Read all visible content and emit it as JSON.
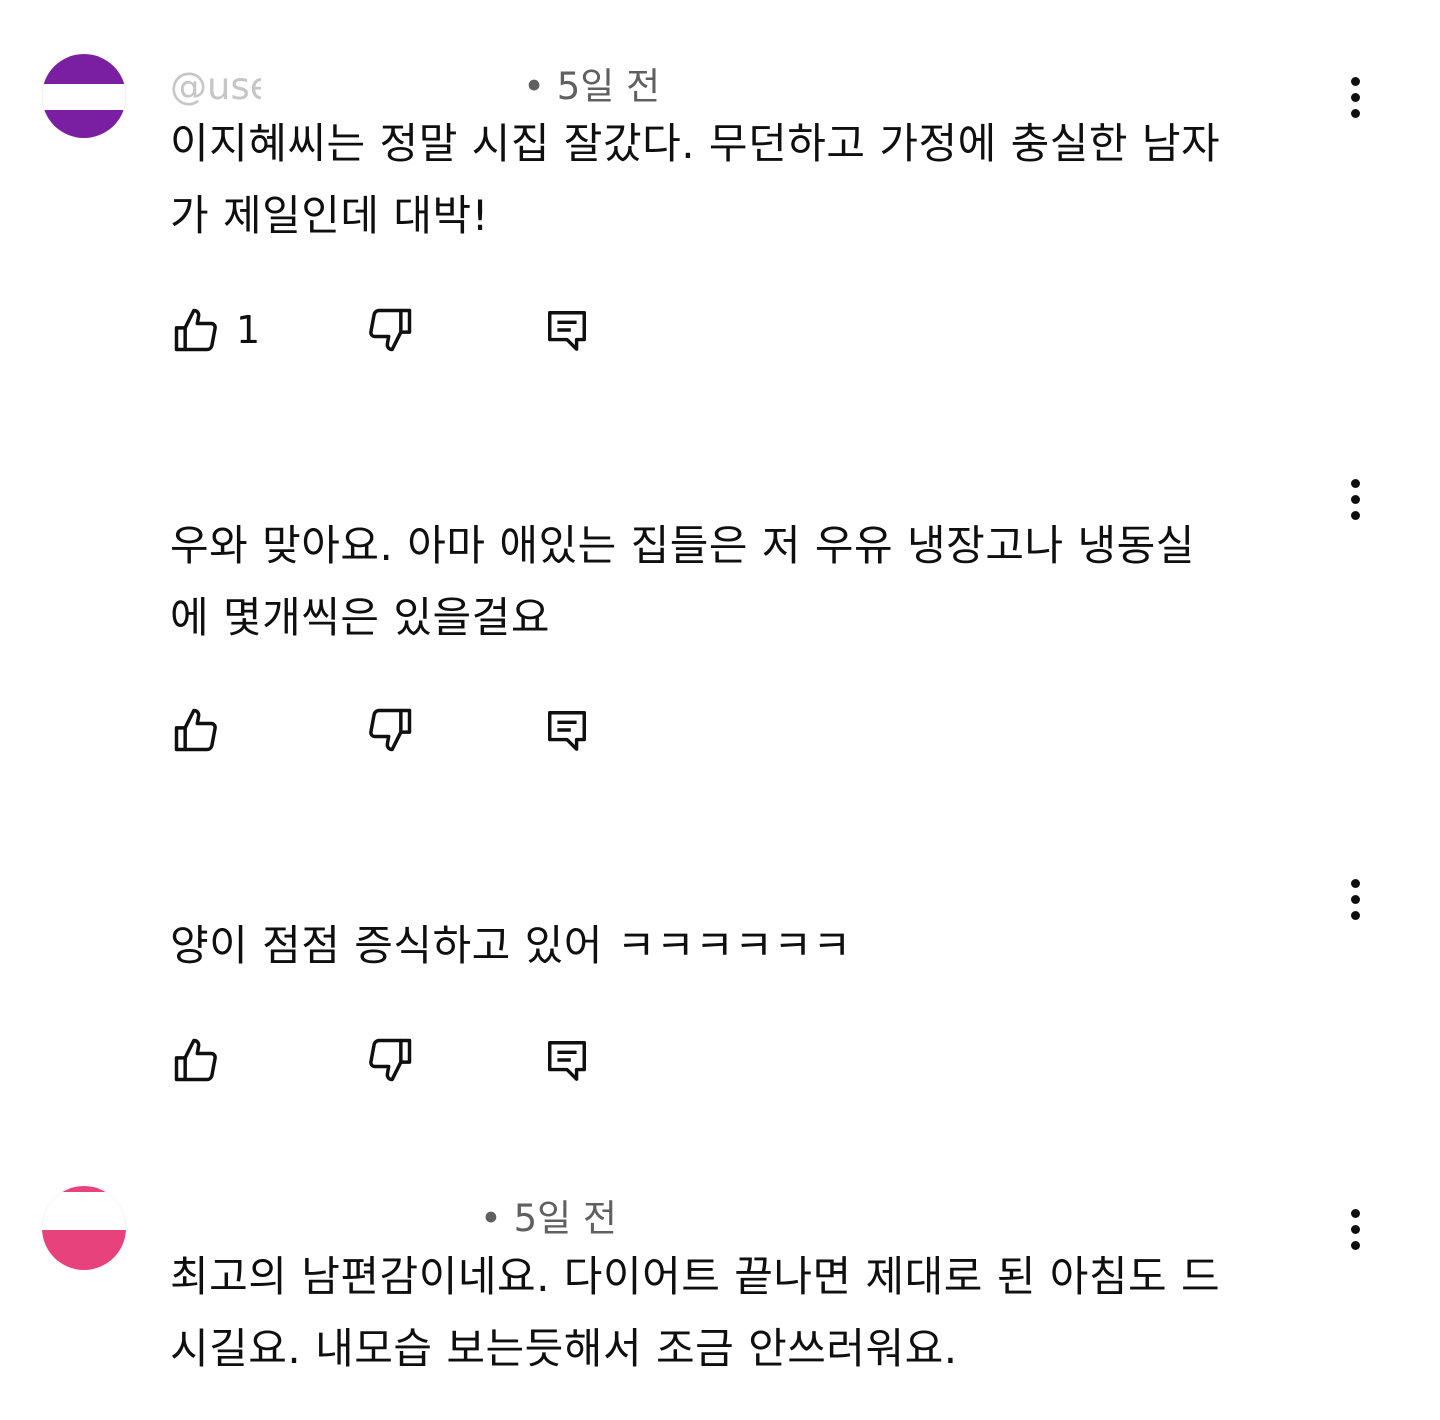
{
  "comments": [
    {
      "meta_visible": "@user-a",
      "time": "• 5일 전",
      "avatar_color": "#7b1fa2",
      "text_line1": "이지혜씨는 정말 시집 잘갔다. 무던하고 가정에 충실한 남자",
      "text_line2": "가 제일인데 대박!",
      "like_count": "1"
    },
    {
      "meta_visible": "",
      "time": "",
      "text_line1": "우와 맞아요. 아마 애있는 집들은 저 우유 냉장고나  냉동실",
      "text_line2": "에 몇개씩은 있을걸요",
      "like_count": ""
    },
    {
      "meta_visible": "",
      "time": "",
      "text_line1": "양이 점점 증식하고 있어 ㅋㅋㅋㅋㅋㅋ",
      "like_count": ""
    },
    {
      "meta_visible": "",
      "time": "• 5일 전",
      "avatar_color": "#e8427c",
      "text_line1": "최고의 남편감이네요.  다이어트 끝나면 제대로 된 아침도 드",
      "text_line2": "시길요.  내모습 보는듯해서 조금 안쓰러워요.",
      "like_count": ""
    }
  ],
  "icons": {
    "like": "thumbs-up-icon",
    "dislike": "thumbs-down-icon",
    "reply": "reply-icon",
    "menu": "more-vert-icon"
  },
  "colors": {
    "text": "#0f0f0f",
    "meta": "#606060"
  }
}
